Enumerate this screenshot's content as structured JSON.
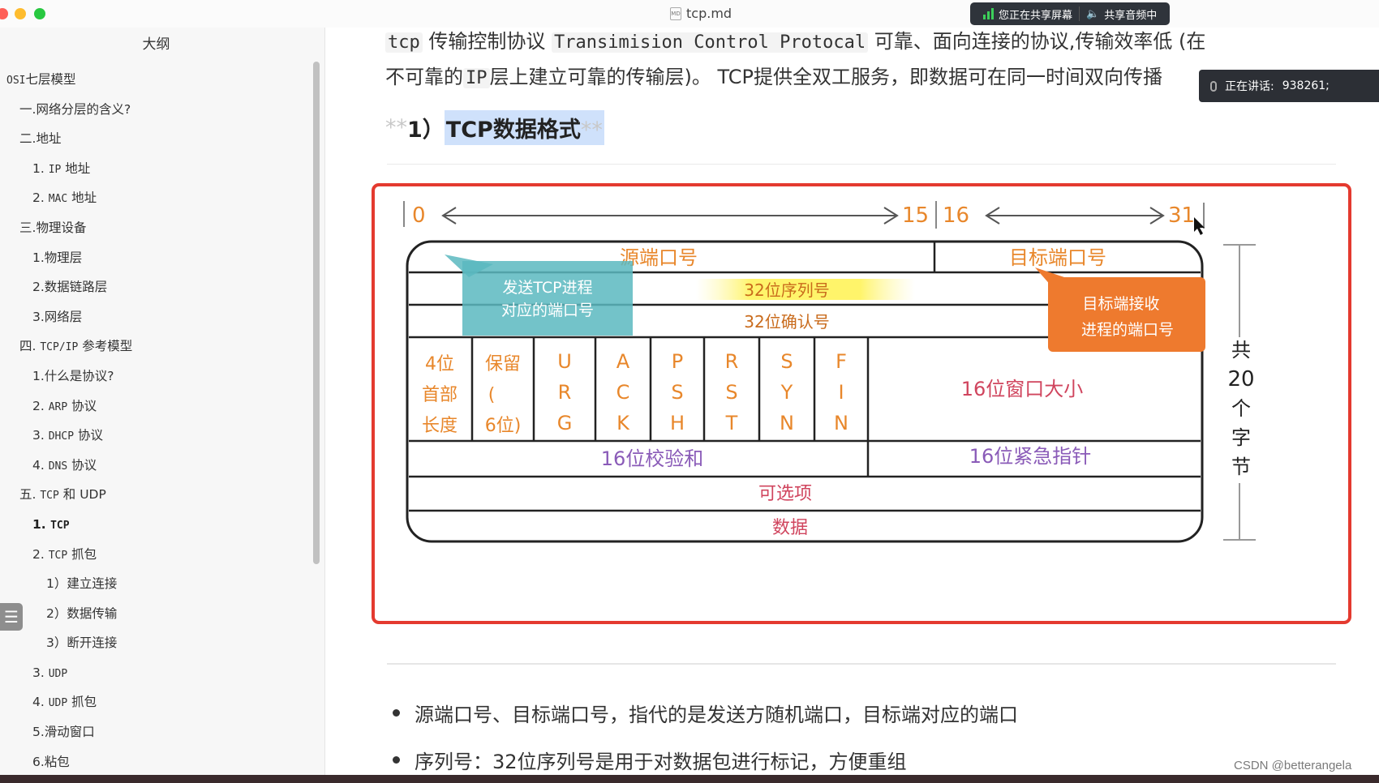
{
  "window": {
    "doc_title": "tcp.md",
    "doc_icon_text": "MD"
  },
  "share": {
    "sharing_label": "您正在共享屏幕",
    "audio_label": "共享音频中",
    "speaking_label": "正在讲话:",
    "speaking_id": "938261;"
  },
  "sidebar": {
    "title": "大纲",
    "items": [
      {
        "level": 1,
        "prefix": "",
        "code": "OSI",
        "text": "七层模型"
      },
      {
        "level": 2,
        "prefix": "一.",
        "code": "",
        "text": "网络分层的含义?"
      },
      {
        "level": 2,
        "prefix": "二.",
        "code": "",
        "text": "地址"
      },
      {
        "level": 3,
        "prefix": "1. ",
        "code": "IP",
        "text": " 地址"
      },
      {
        "level": 3,
        "prefix": "2. ",
        "code": "MAC",
        "text": " 地址"
      },
      {
        "level": 2,
        "prefix": "三.",
        "code": "",
        "text": "物理设备"
      },
      {
        "level": 3,
        "prefix": "1.",
        "code": "",
        "text": "物理层"
      },
      {
        "level": 3,
        "prefix": "2.",
        "code": "",
        "text": "数据链路层"
      },
      {
        "level": 3,
        "prefix": "3.",
        "code": "",
        "text": "网络层"
      },
      {
        "level": 2,
        "prefix": "四. ",
        "code": "TCP/IP",
        "text": " 参考模型"
      },
      {
        "level": 3,
        "prefix": "1.",
        "code": "",
        "text": "什么是协议?"
      },
      {
        "level": 3,
        "prefix": "2. ",
        "code": "ARP",
        "text": " 协议"
      },
      {
        "level": 3,
        "prefix": "3. ",
        "code": "DHCP",
        "text": " 协议"
      },
      {
        "level": 3,
        "prefix": "4. ",
        "code": "DNS",
        "text": " 协议"
      },
      {
        "level": 2,
        "prefix": "五. ",
        "code": "TCP",
        "text": " 和 UDP"
      },
      {
        "level": 3,
        "prefix": "1. ",
        "code": "TCP",
        "text": "",
        "active": true
      },
      {
        "level": 3,
        "prefix": "2. ",
        "code": "TCP",
        "text": " 抓包"
      },
      {
        "level": 4,
        "prefix": "1）",
        "code": "",
        "text": "建立连接"
      },
      {
        "level": 4,
        "prefix": "2）",
        "code": "",
        "text": "数据传输"
      },
      {
        "level": 4,
        "prefix": "3）",
        "code": "",
        "text": "断开连接"
      },
      {
        "level": 3,
        "prefix": "3. ",
        "code": "UDP",
        "text": ""
      },
      {
        "level": 3,
        "prefix": "4. ",
        "code": "UDP",
        "text": " 抓包"
      },
      {
        "level": 3,
        "prefix": "5.",
        "code": "",
        "text": "滑动窗口"
      },
      {
        "level": 3,
        "prefix": "6.",
        "code": "",
        "text": "粘包"
      }
    ]
  },
  "content": {
    "intro": {
      "code1": "tcp",
      "text1": " 传输控制协议 ",
      "code2": "Transimision Control Protocal",
      "text2": " 可靠、面向连接的协议,传输效率低 (在",
      "text3": "不可靠的",
      "code3": "IP",
      "text4": "层上建立可靠的传输层)。 TCP提供全双工服务，即数据可在同一时间双向传播"
    },
    "heading": {
      "stars_left": "**",
      "number": "1）",
      "title": "TCP数据格式",
      "stars_right": "**"
    },
    "diagram": {
      "bit_labels": {
        "start": "0",
        "mid_left": "15",
        "mid_right": "16",
        "end": "31"
      },
      "src_port": "源端口号",
      "dst_port": "目标端口号",
      "seq": "32位序列号",
      "ack": "32位确认号",
      "callout_left": [
        "发送TCP进程",
        "对应的端口号"
      ],
      "callout_right": [
        "目标端接收",
        "进程的端口号"
      ],
      "hdr_len": [
        "4位",
        "首部",
        "长度"
      ],
      "reserved": [
        "保留",
        "(",
        "6位)"
      ],
      "flags": [
        [
          "U",
          "R",
          "G"
        ],
        [
          "A",
          "C",
          "K"
        ],
        [
          "P",
          "S",
          "H"
        ],
        [
          "R",
          "S",
          "T"
        ],
        [
          "S",
          "Y",
          "N"
        ],
        [
          "F",
          "I",
          "N"
        ]
      ],
      "window": "16位窗口大小",
      "checksum": "16位校验和",
      "urgent": "16位紧急指针",
      "options": "可选项",
      "data": "数据",
      "total": [
        "共",
        "20",
        "个",
        "字",
        "节"
      ],
      "colors": {
        "orange": "#e8872b",
        "purple": "#8a5bb8",
        "pink": "#d0455e",
        "teal": "#5ab8bf",
        "callout_orange": "#ee7a2e",
        "frame_red": "#e43a2f"
      }
    },
    "bullets": [
      "源端口号、目标端口号，指代的是发送方随机端口，目标端对应的端口",
      "序列号：32位序列号是用于对数据包进行标记，方便重组"
    ]
  },
  "watermark": "CSDN @betterangela"
}
